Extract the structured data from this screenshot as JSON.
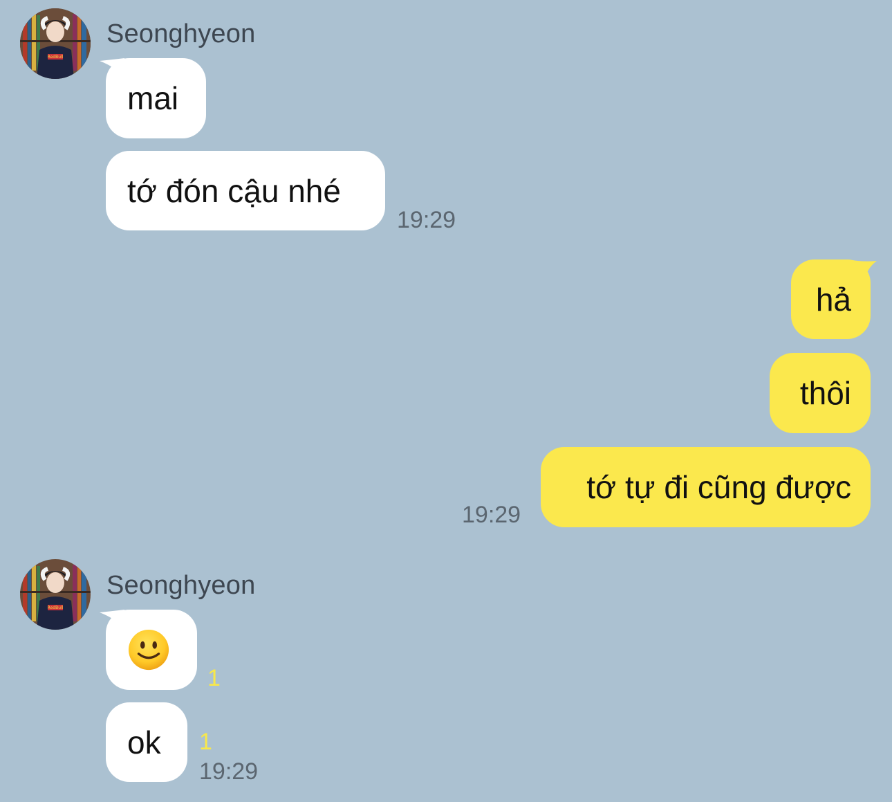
{
  "colors": {
    "background": "#abc1d1",
    "incoming_bubble": "#ffffff",
    "outgoing_bubble": "#fbe84d",
    "unread_count": "#f8e84a",
    "time_text": "#5b6670"
  },
  "groups": [
    {
      "sender": "Seonghyeon",
      "avatar_icon": "avatar-photo-icon",
      "messages": [
        {
          "text": "mai"
        },
        {
          "text": "tớ đón cậu nhé",
          "time": "19:29"
        }
      ]
    },
    {
      "sender": "me",
      "messages": [
        {
          "text": "hả"
        },
        {
          "text": "thôi"
        },
        {
          "text": "tớ tự đi cũng được",
          "time": "19:29"
        }
      ]
    },
    {
      "sender": "Seonghyeon",
      "avatar_icon": "avatar-photo-icon",
      "messages": [
        {
          "emoji": "slightly-smiling-face-icon",
          "unread": "1"
        },
        {
          "text": "ok",
          "unread": "1",
          "time": "19:29"
        }
      ]
    }
  ]
}
